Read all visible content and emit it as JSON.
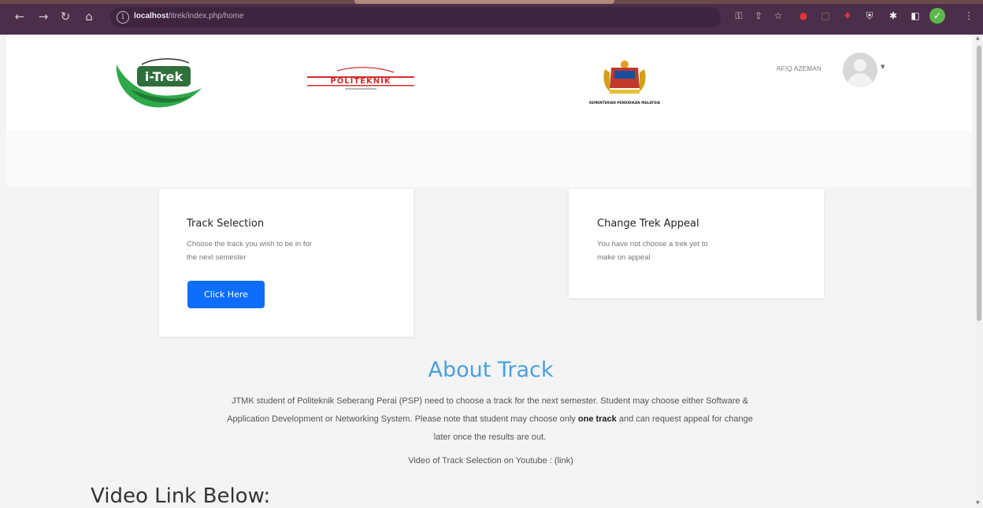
{
  "browser": {
    "url_host": "localhost",
    "url_path": "/itrek/index.php/home",
    "icons": [
      "back-icon",
      "forward-icon",
      "reload-icon",
      "home-icon",
      "info-icon",
      "key-icon",
      "share-icon",
      "star-icon",
      "extensions-icon",
      "profile-icon",
      "menu-icon"
    ],
    "accent_color": "#4a2e4a"
  },
  "header": {
    "logos": [
      "i-Trek logo",
      "Politeknik logo",
      "Kementerian Pendidikan Malaysia logo"
    ],
    "itrek_logo_text": "i-Trek",
    "poli_logo_text": "POLITEKNIK",
    "kpm_logo_text": "KEMENTERIAN PENDIDIKAN MALAYSIA",
    "user_name": "AFIQ AZEMAN"
  },
  "cards": {
    "track": {
      "title": "Track Selection",
      "text_line1": "Choose the track you wish to be in for",
      "text_line2": "the next semester",
      "button_label": "Click Here"
    },
    "appeal": {
      "title": "Change Trek Appeal",
      "text_line1": "You have not choose a trek yet to",
      "text_line2": "make on appeal"
    }
  },
  "about": {
    "title": "About Track",
    "line1": "JTMK student of Politeknik Seberang Perai (PSP) need to choose a track for the next semester. Student may choose either Software &",
    "line2_before": "Application Development or Networking System. Please note that student may choose only ",
    "line2_bold": "one track",
    "line2_after": " and can request appeal for change",
    "line3": "later once the results are out.",
    "video_text": "Video of Track Selection on Youtube : (link)"
  },
  "video_heading": "Video Link Below:",
  "colors": {
    "primary_button": "#0d6efd",
    "about_title": "#4aa0dd",
    "page_background": "#f4f4f5"
  }
}
